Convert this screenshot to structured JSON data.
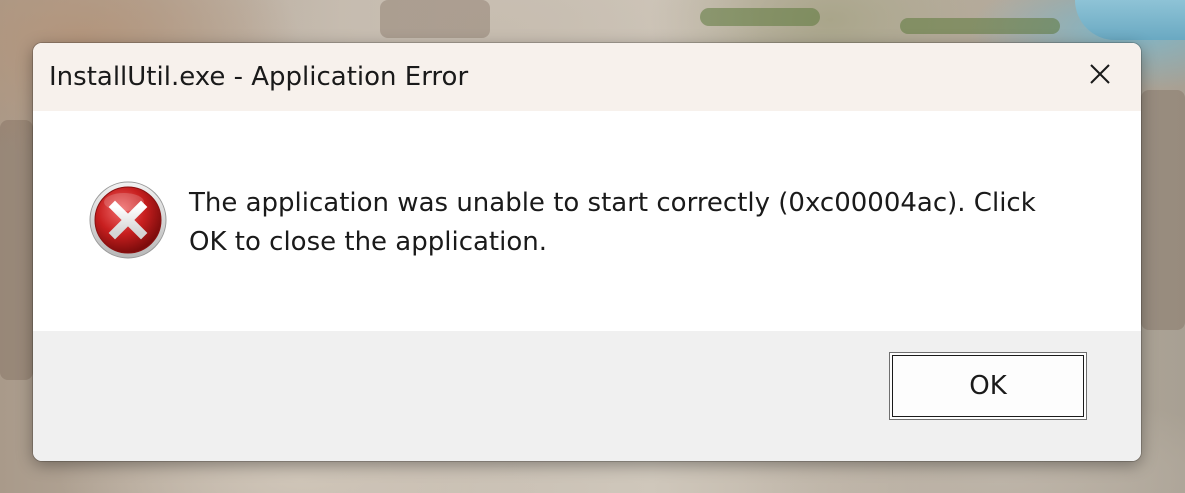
{
  "dialog": {
    "title": "InstallUtil.exe - Application Error",
    "message": "The application was unable to start correctly (0xc00004ac). Click OK to close the application.",
    "ok_label": "OK",
    "icon": "error-icon",
    "close_icon": "close-icon"
  },
  "colors": {
    "titlebar_bg": "#f7f1ec",
    "content_bg": "#ffffff",
    "footer_bg": "#f0f0f0",
    "error_red": "#c81f1f"
  }
}
